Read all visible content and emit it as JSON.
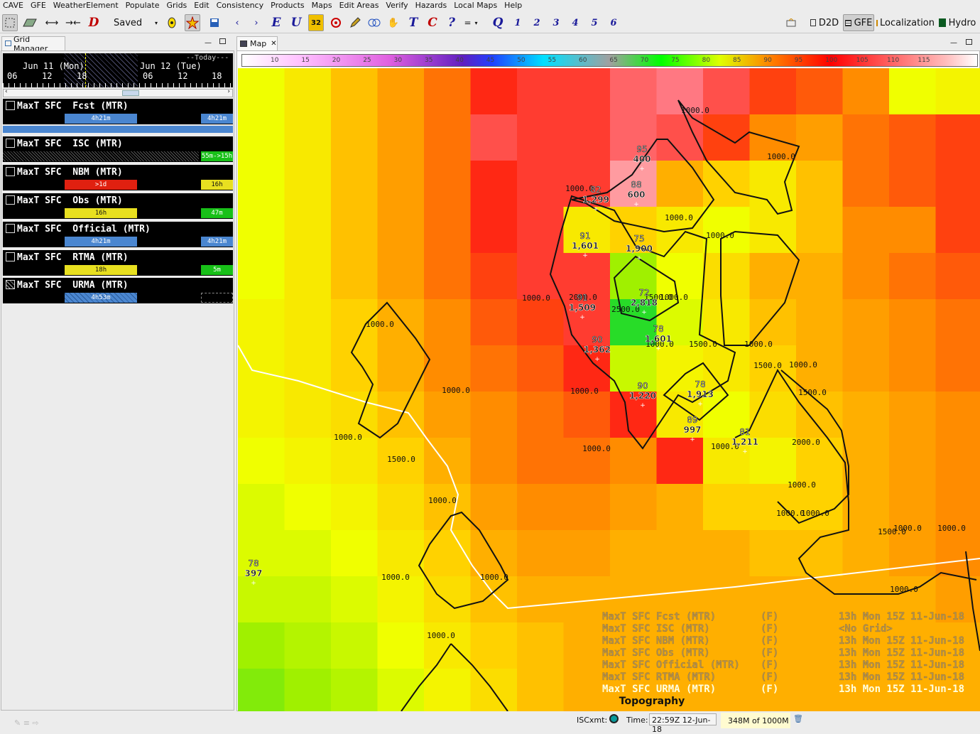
{
  "menu": [
    "CAVE",
    "GFE",
    "WeatherElement",
    "Populate",
    "Grids",
    "Edit",
    "Consistency",
    "Products",
    "Maps",
    "Edit Areas",
    "Verify",
    "Hazards",
    "Local Maps",
    "Help"
  ],
  "toolbar": {
    "saved_label": "Saved",
    "letters": [
      "E",
      "U",
      "T",
      "C",
      "?",
      "=",
      "Q",
      "1",
      "2",
      "3",
      "4",
      "5",
      "6"
    ],
    "num32": "32",
    "perspectives": [
      "D2D",
      "GFE",
      "Localization",
      "Hydro"
    ]
  },
  "grid_manager": {
    "title": "Grid Manager",
    "time_header": {
      "today": "Today",
      "day1": "Jun 11 (Mon)",
      "day2": "Jun 12 (Tue)",
      "hours": [
        "06",
        "12",
        "18",
        "06",
        "12",
        "18"
      ]
    },
    "rows": [
      {
        "label": "MaxT SFC  Fcst (MTR)",
        "bars": [
          {
            "text": "4h21m",
            "cls": "blue"
          }
        ],
        "right": {
          "text": "4h21m",
          "cls": "blue"
        }
      },
      {
        "label": "MaxT SFC  ISC (MTR)",
        "bars": [],
        "right": {
          "text": "55m->15h",
          "cls": "green"
        }
      },
      {
        "label": "MaxT SFC  NBM (MTR)",
        "bars": [
          {
            "text": ">1d",
            "cls": "red"
          }
        ],
        "right": {
          "text": "16h",
          "cls": "yellow"
        }
      },
      {
        "label": "MaxT SFC  Obs (MTR)",
        "bars": [
          {
            "text": "16h",
            "cls": "yellow"
          }
        ],
        "right": {
          "text": "47m",
          "cls": "green"
        }
      },
      {
        "label": "MaxT SFC  Official (MTR)",
        "bars": [
          {
            "text": "4h21m",
            "cls": "blue"
          }
        ],
        "right": {
          "text": "4h21m",
          "cls": "blue"
        }
      },
      {
        "label": "MaxT SFC  RTMA (MTR)",
        "bars": [
          {
            "text": "18h",
            "cls": "yellow"
          }
        ],
        "right": {
          "text": "5m",
          "cls": "green"
        }
      },
      {
        "label": "MaxT SFC  URMA (MTR)",
        "bars": [
          {
            "text": "4h53m",
            "cls": "blue"
          }
        ],
        "right": {
          "text": "",
          "cls": ""
        }
      }
    ]
  },
  "map": {
    "tab_label": "Map",
    "colorbar_ticks": [
      "10",
      "15",
      "20",
      "25",
      "30",
      "35",
      "40",
      "45",
      "50",
      "55",
      "60",
      "65",
      "70",
      "75",
      "80",
      "85",
      "90",
      "95",
      "100",
      "105",
      "110",
      "115"
    ],
    "contour_labels": [
      {
        "t": "1000.0"
      },
      {
        "t": "1000.0"
      },
      {
        "t": "1000.0"
      },
      {
        "t": "1000.0"
      },
      {
        "t": "1000.0"
      },
      {
        "t": "1000.0"
      },
      {
        "t": "1000.0"
      },
      {
        "t": "2000.0"
      },
      {
        "t": "1500.0"
      },
      {
        "t": "2500.0"
      },
      {
        "t": "1000.0"
      },
      {
        "t": "1500.0"
      },
      {
        "t": "1000.0"
      },
      {
        "t": "1500.0"
      },
      {
        "t": "1000.0"
      },
      {
        "t": "1500.0"
      },
      {
        "t": "1000.0"
      },
      {
        "t": "1000.0"
      },
      {
        "t": "1000.0"
      },
      {
        "t": "1000.0"
      },
      {
        "t": "1500.0"
      },
      {
        "t": "2000.0"
      },
      {
        "t": "1000.0"
      },
      {
        "t": "1000.0"
      },
      {
        "t": "1000.0"
      },
      {
        "t": "1000.0"
      },
      {
        "t": "1000.0"
      },
      {
        "t": "1000.0"
      },
      {
        "t": "1500.0"
      },
      {
        "t": "1000.0"
      },
      {
        "t": "1000.0"
      },
      {
        "t": "1000.0"
      },
      {
        "t": "1000.0"
      },
      {
        "t": "1000.0"
      },
      {
        "t": "1000.0"
      }
    ],
    "stations": [
      {
        "temp": "95",
        "elev": "400"
      },
      {
        "temp": "88",
        "elev": "600"
      },
      {
        "temp": "82",
        "elev": "1,299"
      },
      {
        "temp": "91",
        "elev": "1,601"
      },
      {
        "temp": "75",
        "elev": "1,900"
      },
      {
        "temp": "72",
        "elev": "2,818"
      },
      {
        "temp": "91",
        "elev": "1,509"
      },
      {
        "temp": "78",
        "elev": "1,601"
      },
      {
        "temp": "90",
        "elev": "1,362"
      },
      {
        "temp": "90",
        "elev": "1,220"
      },
      {
        "temp": "78",
        "elev": "1,913"
      },
      {
        "temp": "89",
        "elev": "997"
      },
      {
        "temp": "81",
        "elev": "1,211"
      },
      {
        "temp": "78",
        "elev": "397"
      }
    ],
    "legend": [
      {
        "name": "MaxT SFC Fcst (MTR)",
        "unit": "(F)",
        "time": "13h Mon 15Z 11-Jun-18"
      },
      {
        "name": "MaxT SFC ISC (MTR)",
        "unit": "(F)",
        "time": "<No Grid>"
      },
      {
        "name": "MaxT SFC NBM (MTR)",
        "unit": "(F)",
        "time": "13h Mon 15Z 11-Jun-18"
      },
      {
        "name": "MaxT SFC Obs (MTR)",
        "unit": "(F)",
        "time": "13h Mon 15Z 11-Jun-18"
      },
      {
        "name": "MaxT SFC Official (MTR)",
        "unit": "(F)",
        "time": "13h Mon 15Z 11-Jun-18"
      },
      {
        "name": "MaxT SFC RTMA (MTR)",
        "unit": "(F)",
        "time": "13h Mon 15Z 11-Jun-18"
      },
      {
        "name": "MaxT SFC URMA (MTR)",
        "unit": "(F)",
        "time": "13h Mon 15Z 11-Jun-18"
      }
    ],
    "topography_label": "Topography"
  },
  "status": {
    "isc_label": "ISCxmt:",
    "time_label": "Time:",
    "time_value": "22:59Z 12-Jun-18",
    "memory": "348M of 1000M"
  }
}
